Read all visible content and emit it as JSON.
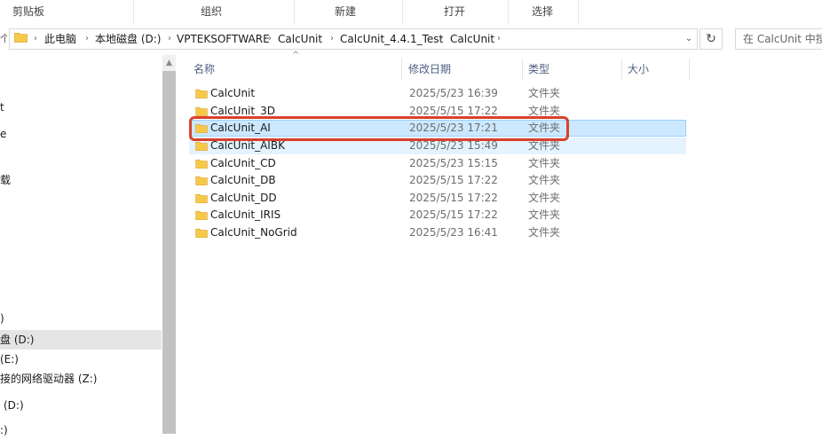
{
  "ribbon": {
    "groups": [
      "剪贴板",
      "组织",
      "新建",
      "打开",
      "选择"
    ]
  },
  "address": {
    "up_arrow": "个",
    "crumbs": [
      "此电脑",
      "本地磁盘 (D:)",
      "VPTEKSOFTWARE",
      "CalcUnit",
      "CalcUnit_4.4.1_Test",
      "CalcUnit"
    ],
    "search_placeholder": "在 CalcUnit 中搜索"
  },
  "nav": {
    "items": [
      {
        "label": "t"
      },
      {
        "label": "e"
      },
      {
        "label": "载"
      },
      {
        "label": ")"
      },
      {
        "label": "盘 (D:)",
        "selected": true
      },
      {
        "label": "(E:)"
      },
      {
        "label": "接的网络驱动器 (Z:)"
      },
      {
        "label": "(D:)"
      },
      {
        "label": ":)"
      }
    ]
  },
  "columns": {
    "name": "名称",
    "modified": "修改日期",
    "type": "类型",
    "size": "大小"
  },
  "files": [
    {
      "name": "CalcUnit",
      "modified": "2025/5/23 16:39",
      "type": "文件夹",
      "size": ""
    },
    {
      "name": "CalcUnit_3D",
      "modified": "2025/5/15 17:22",
      "type": "文件夹",
      "size": ""
    },
    {
      "name": "CalcUnit_AI",
      "modified": "2025/5/23 17:21",
      "type": "文件夹",
      "size": "",
      "selected": true
    },
    {
      "name": "CalcUnit_AIBK",
      "modified": "2025/5/23 15:49",
      "type": "文件夹",
      "size": ""
    },
    {
      "name": "CalcUnit_CD",
      "modified": "2025/5/23 15:15",
      "type": "文件夹",
      "size": ""
    },
    {
      "name": "CalcUnit_DB",
      "modified": "2025/5/15 17:22",
      "type": "文件夹",
      "size": ""
    },
    {
      "name": "CalcUnit_DD",
      "modified": "2025/5/15 17:22",
      "type": "文件夹",
      "size": ""
    },
    {
      "name": "CalcUnit_IRIS",
      "modified": "2025/5/15 17:22",
      "type": "文件夹",
      "size": ""
    },
    {
      "name": "CalcUnit_NoGrid",
      "modified": "2025/5/23 16:41",
      "type": "文件夹",
      "size": ""
    }
  ],
  "colors": {
    "folder_yellow": "#f7c948",
    "selection_bg": "#cce8ff",
    "highlight_red": "#d9412b"
  },
  "icons": {
    "folder": "folder-icon",
    "refresh": "refresh-icon",
    "dropdown": "chevron-down-icon",
    "breadcrumb_sep": "chevron-right-icon"
  }
}
